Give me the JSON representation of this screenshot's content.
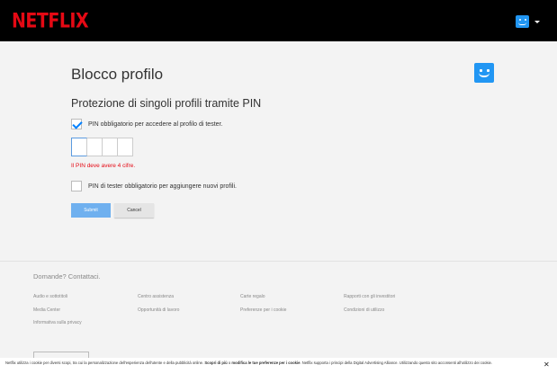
{
  "header": {
    "logo_text": "NETFLIX",
    "profile_icon": "profile-avatar-icon",
    "menu_icon": "caret-down-icon"
  },
  "main": {
    "title": "Blocco profilo",
    "section_title": "Protezione di singoli profili tramite PIN",
    "pin_required_label": "PIN obbligatorio per accedere al profilo di tester.",
    "pin_required_checked": true,
    "pin_digits": [
      "",
      "",
      "",
      ""
    ],
    "pin_error": "Il PIN deve avere 4 cifre.",
    "new_profile_pin_label": "PIN di tester obbligatorio per aggiungere nuovi profili.",
    "new_profile_pin_checked": false,
    "submit_label": "Submit",
    "cancel_label": "Cancel"
  },
  "footer": {
    "contact": "Domande? Contattaci.",
    "links": [
      "Audio e sottotitoli",
      "Centro assistenza",
      "Carte regalo",
      "Rapporti con gli investitori",
      "Media Center",
      "Opportunità di lavoro",
      "Preferenze per i cookie",
      "Condizioni di utilizzo",
      "Informativa sulla privacy"
    ]
  },
  "cookie_banner": {
    "text_1": "Netflix utilizza i cookie per diversi scopi, tra cui la personalizzazione dell'esperienza dell'utente e della pubblicità online. ",
    "link_1": "Scopri di più",
    "text_2": " o ",
    "link_2": "modifica le tue preferenze per i cookie",
    "text_3": ". Netflix supporta i principi della Digital Advertising Alliance. Utilizzando questo sito acconsenti all'utilizzo dei cookie.",
    "close": "✕"
  },
  "colors": {
    "brand_red": "#e50914",
    "avatar_blue": "#2196f3",
    "submit_blue": "#6fb0ef",
    "check_blue": "#0080ff"
  }
}
